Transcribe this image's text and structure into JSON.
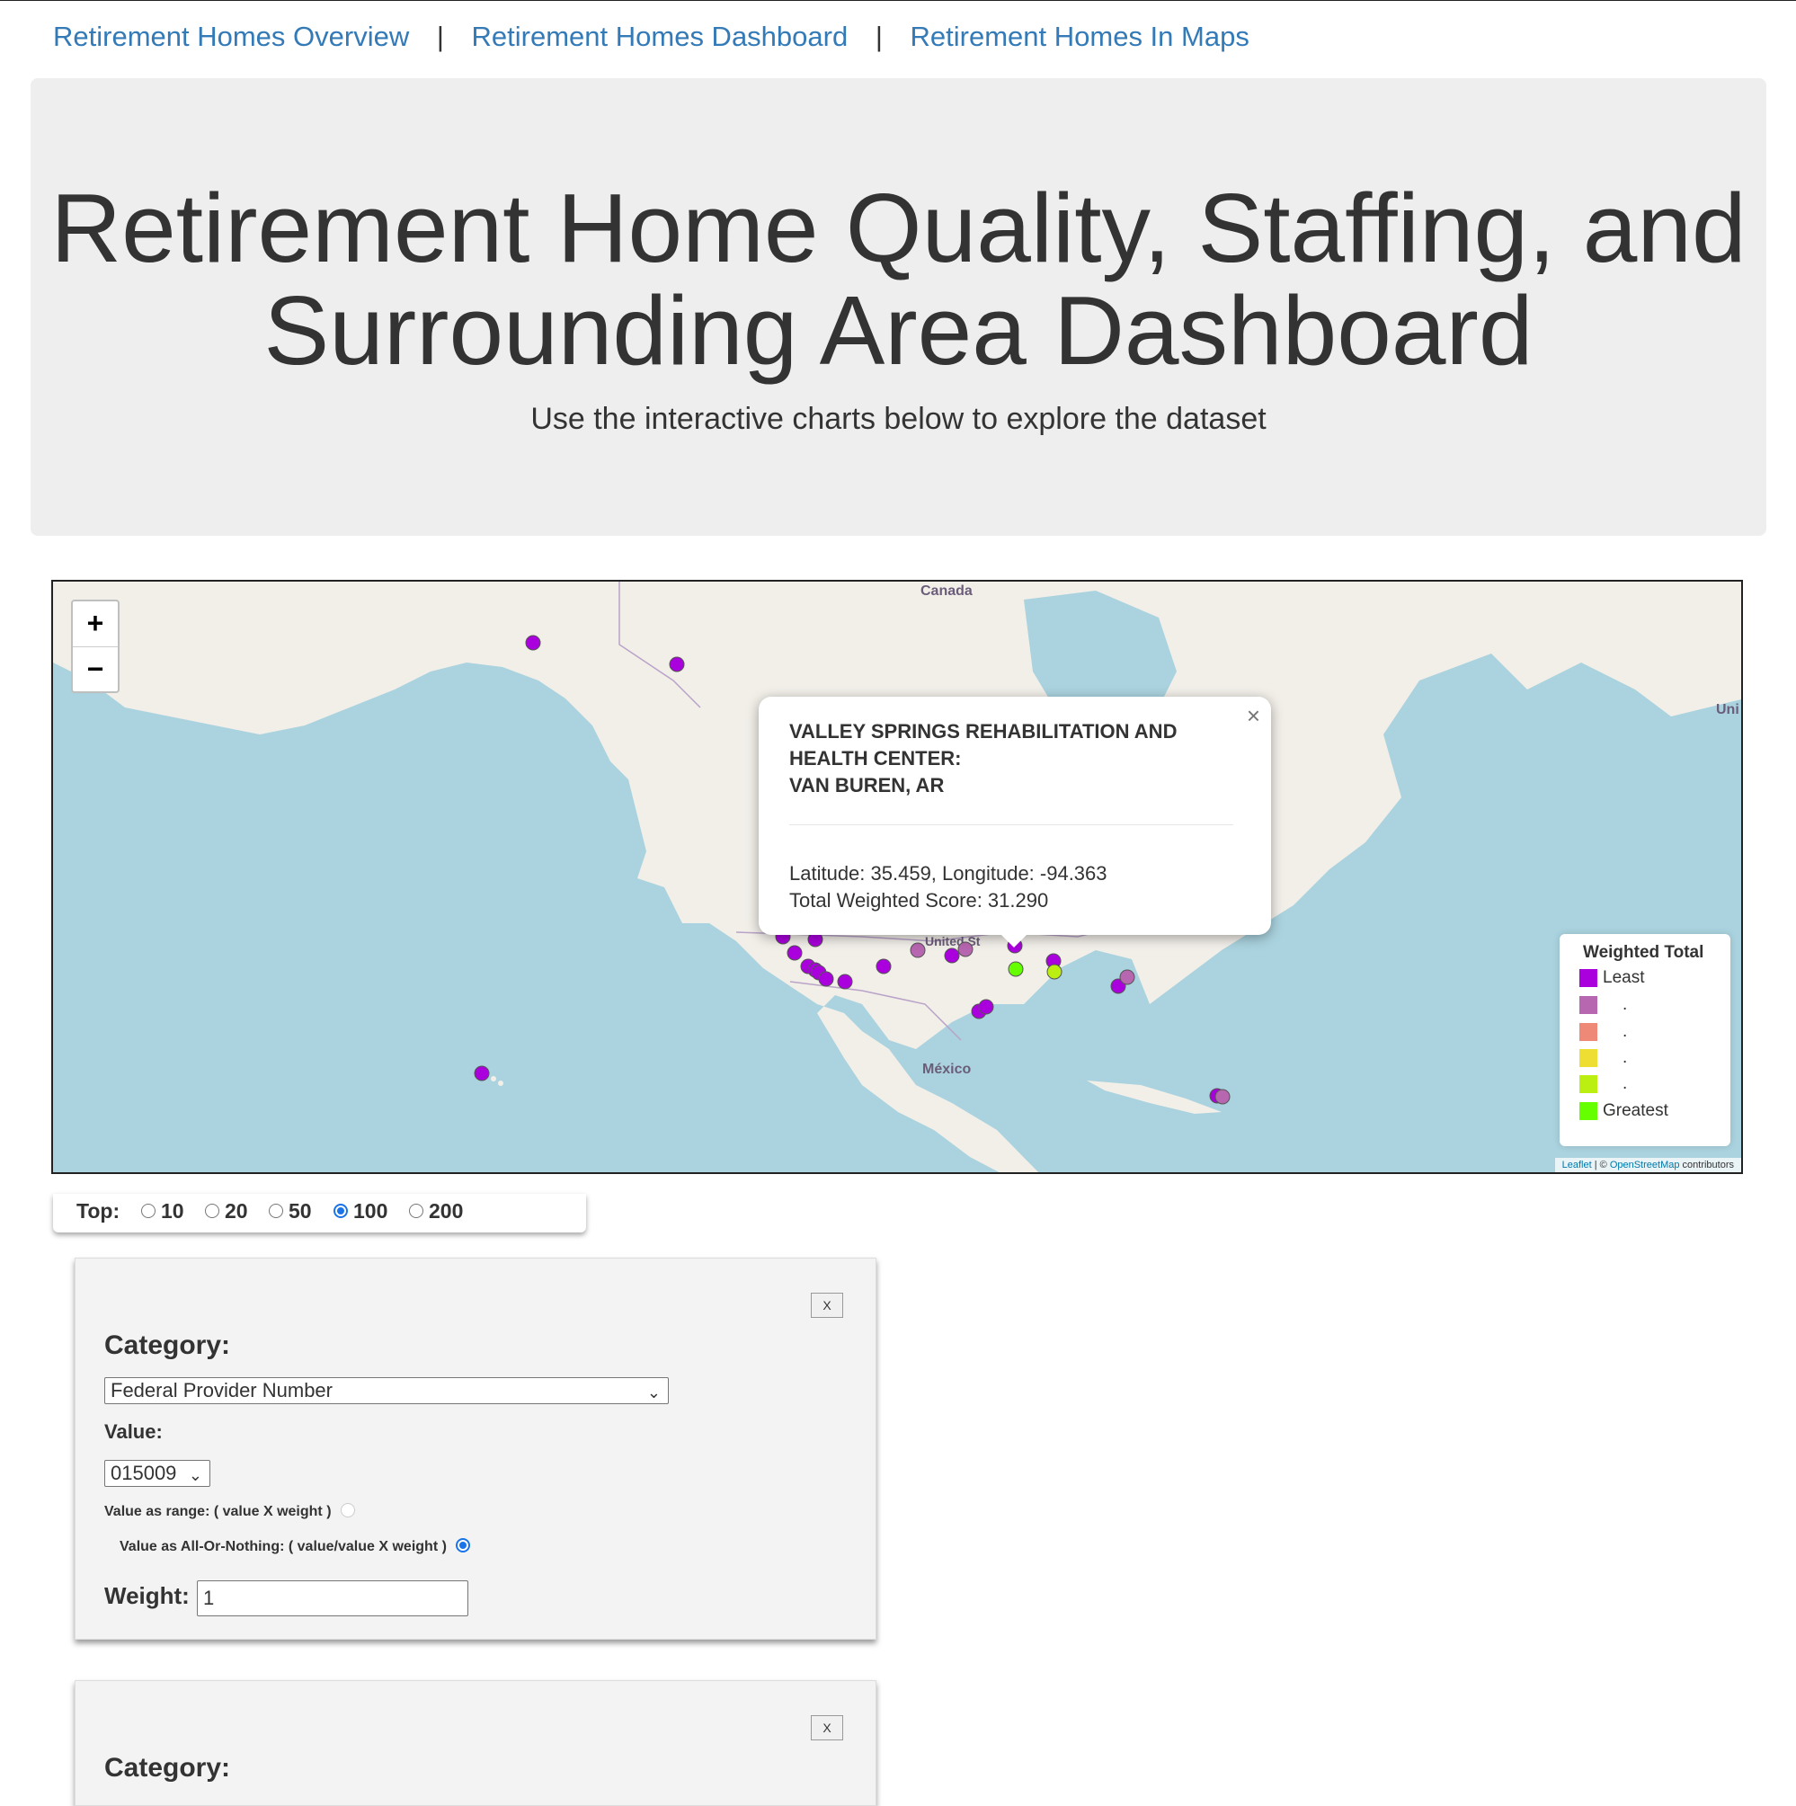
{
  "nav": {
    "links": [
      "Retirement Homes Overview",
      "Retirement Homes Dashboard",
      "Retirement Homes In Maps"
    ],
    "separator": "|"
  },
  "header": {
    "title": "Retirement Home Quality, Staffing, and Surrounding Area Dashboard",
    "subtitle": "Use the interactive charts below to explore the dataset"
  },
  "map": {
    "zoom_in": "+",
    "zoom_out": "−",
    "labels": {
      "canada": "Canada",
      "mexico": "México",
      "uk_partial": "Uni",
      "us_partial": "United St"
    },
    "popup": {
      "title_line1": "VALLEY SPRINGS REHABILITATION AND",
      "title_line2": "HEALTH CENTER:",
      "title_line3": "VAN BUREN, AR",
      "coords": "Latitude: 35.459, Longitude: -94.363",
      "score": "Total Weighted Score: 31.290",
      "close": "×"
    },
    "legend": {
      "title": "Weighted Total",
      "items": [
        {
          "label": "Least",
          "color": "#aa00dd"
        },
        {
          "label": ".",
          "color": "#b766b0"
        },
        {
          "label": ".",
          "color": "#ee8877"
        },
        {
          "label": ".",
          "color": "#eedd33"
        },
        {
          "label": ".",
          "color": "#bbee11"
        },
        {
          "label": "Greatest",
          "color": "#66ff00"
        }
      ]
    },
    "attribution": {
      "leaflet": "Leaflet",
      "sep": " | © ",
      "osm": "OpenStreetMap",
      "rest": " contributors"
    }
  },
  "top_selector": {
    "label": "Top:",
    "options": [
      "10",
      "20",
      "50",
      "100",
      "200"
    ],
    "selected": "100"
  },
  "filter_cards": [
    {
      "remove": "X",
      "category_label": "Category:",
      "category_value": "Federal Provider Number",
      "value_label": "Value:",
      "value_selected": "015009",
      "range_label": "Value as range: ( value X weight )",
      "aon_label": "Value as All-Or-Nothing: ( value/value X weight )",
      "weight_label": "Weight:",
      "weight_value": "1"
    },
    {
      "remove": "X",
      "category_label": "Category:"
    }
  ]
}
